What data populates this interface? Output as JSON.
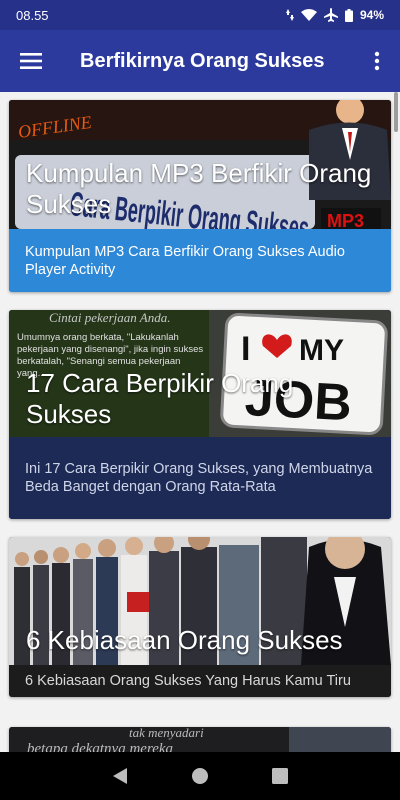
{
  "status_bar": {
    "time": "08.55",
    "battery": "94%"
  },
  "app_bar": {
    "title": "Berfikirnya Orang Sukses"
  },
  "cards": [
    {
      "overlay_title": "Kumpulan MP3 Berfikir Orang Sukses",
      "caption": "Kumpulan MP3 Cara Berfikir Orang Sukses Audio Player Activity",
      "image_text": [
        "OFFLINE",
        "Cara Berpikir Orang Sukses",
        "MP3"
      ],
      "caption_color": "#2d88d8"
    },
    {
      "overlay_title": "17 Cara Berpikir Orang Sukses",
      "caption": "Ini 17 Cara Berpikir Orang Sukses, yang Membuatnya Beda Banget dengan Orang Rata-Rata",
      "image_text": [
        "Cintai pekerjaan Anda.",
        "Umumnya orang berkata, \"Lakukanlah pekerjaan yang disenangi\", jika ingin sukses berkatalah, \"Senangi semua pekerjaan yang...",
        "I",
        "MY",
        "JOB"
      ],
      "caption_color": "#1d2a55"
    },
    {
      "overlay_title": "6 Kebiasaan Orang Sukses",
      "caption": "6 Kebiasaan Orang Sukses Yang Harus Kamu Tiru",
      "caption_color": "#1c1c1c"
    },
    {
      "image_text": [
        "tak menyadari",
        "betapa dekatnya mereka"
      ]
    }
  ],
  "icons": {
    "menu": "hamburger-icon",
    "more": "more-vert-icon",
    "back": "back-triangle-icon",
    "home": "home-circle-icon",
    "recents": "recents-square-icon"
  }
}
